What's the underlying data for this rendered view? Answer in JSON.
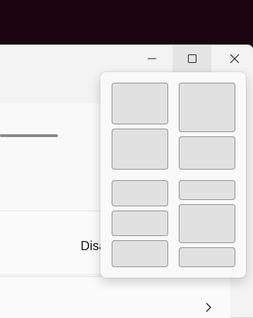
{
  "window": {
    "caption": {
      "minimize_icon": "minimize-icon",
      "maximize_icon": "maximize-icon",
      "close_icon": "close-icon"
    }
  },
  "setting_card": {
    "value": "Disa"
  },
  "nav_card": {
    "chevron_icon": "chevron-right-icon"
  },
  "snap_layouts": {
    "layouts": [
      {
        "name": "two-columns-top-bottom",
        "zones": 2
      },
      {
        "name": "two-columns-large-top",
        "zones": 2
      },
      {
        "name": "three-rows-equal",
        "zones": 3
      },
      {
        "name": "three-rows-large-middle",
        "zones": 3
      }
    ]
  },
  "colors": {
    "desktop": "#190410",
    "window_bg": "#f3f3f3",
    "zone_fill": "#e1e1e1",
    "zone_border": "#8f8f8f",
    "hover_bg": "#e5e5e5"
  }
}
